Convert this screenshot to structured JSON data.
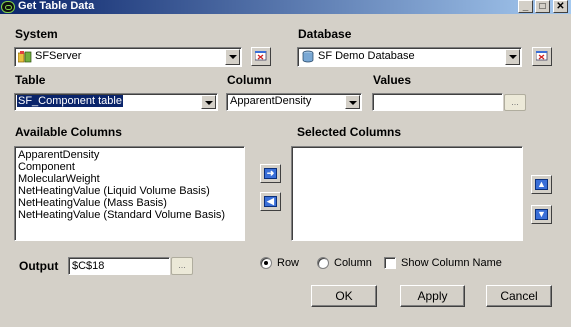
{
  "window": {
    "title": "Get Table Data",
    "controls": {
      "minimize": "_",
      "maximize": "□",
      "close": "✕"
    }
  },
  "system": {
    "label": "System",
    "value": "SFServer"
  },
  "database": {
    "label": "Database",
    "value": "SF Demo Database"
  },
  "table": {
    "label": "Table",
    "value": "SF_Component table"
  },
  "column": {
    "label": "Column",
    "value": "ApparentDensity"
  },
  "values": {
    "label": "Values",
    "value": "",
    "dots": "..."
  },
  "available_columns": {
    "label": "Available Columns",
    "items": [
      "ApparentDensity",
      "Component",
      "MolecularWeight",
      "NetHeatingValue (Liquid Volume Basis)",
      "NetHeatingValue (Mass Basis)",
      "NetHeatingValue (Standard Volume Basis)"
    ]
  },
  "selected_columns": {
    "label": "Selected Columns",
    "items": []
  },
  "output": {
    "label": "Output",
    "value": "$C$18",
    "dots": "..."
  },
  "orientation": {
    "row": "Row",
    "column": "Column",
    "selected": "Row"
  },
  "show_column_name": {
    "label": "Show Column Name",
    "checked": false
  },
  "buttons": {
    "ok": "OK",
    "apply": "Apply",
    "cancel": "Cancel"
  },
  "colors": {
    "titlebar_start": "#0a246a",
    "titlebar_end": "#a6caf0",
    "face": "#d4d0c8",
    "arrow_blue": "#3a6fd8"
  }
}
